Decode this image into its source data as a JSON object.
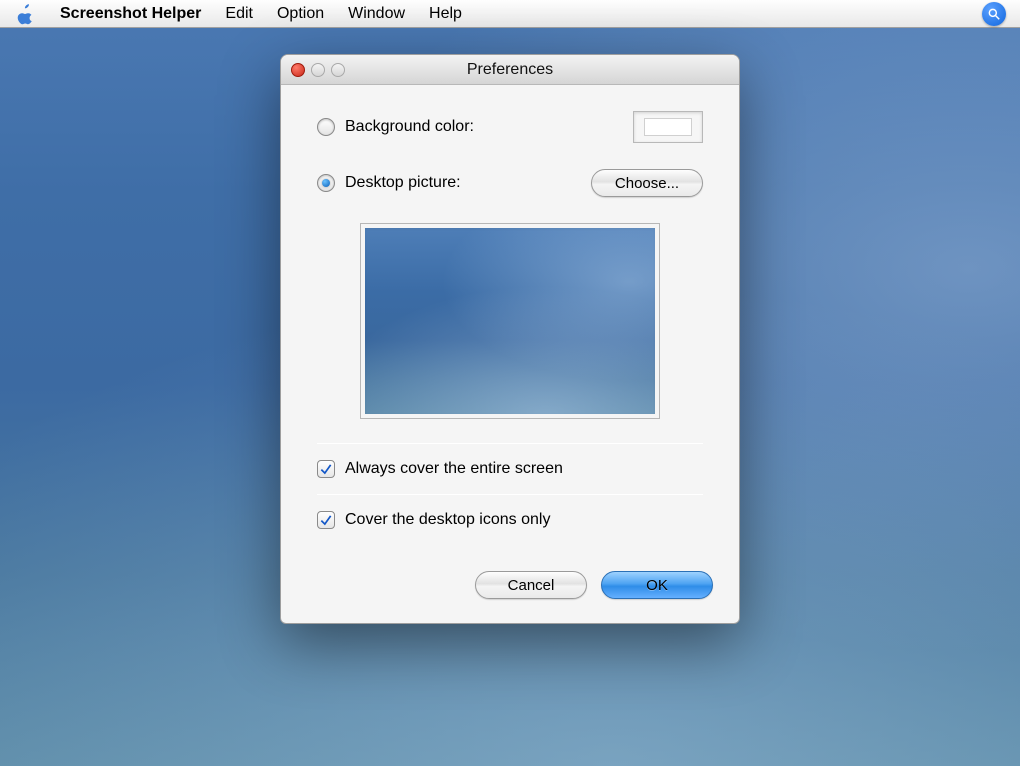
{
  "menubar": {
    "app_name": "Screenshot Helper",
    "items": [
      "Edit",
      "Option",
      "Window",
      "Help"
    ]
  },
  "window": {
    "title": "Preferences",
    "background_color_label": "Background color:",
    "desktop_picture_label": "Desktop picture:",
    "choose_label": "Choose...",
    "check1_label": "Always cover the entire screen",
    "check2_label": "Cover the desktop icons only",
    "cancel_label": "Cancel",
    "ok_label": "OK",
    "background_color_value": "#ffffff",
    "radio_selected": "desktop_picture",
    "check1_checked": true,
    "check2_checked": true
  }
}
